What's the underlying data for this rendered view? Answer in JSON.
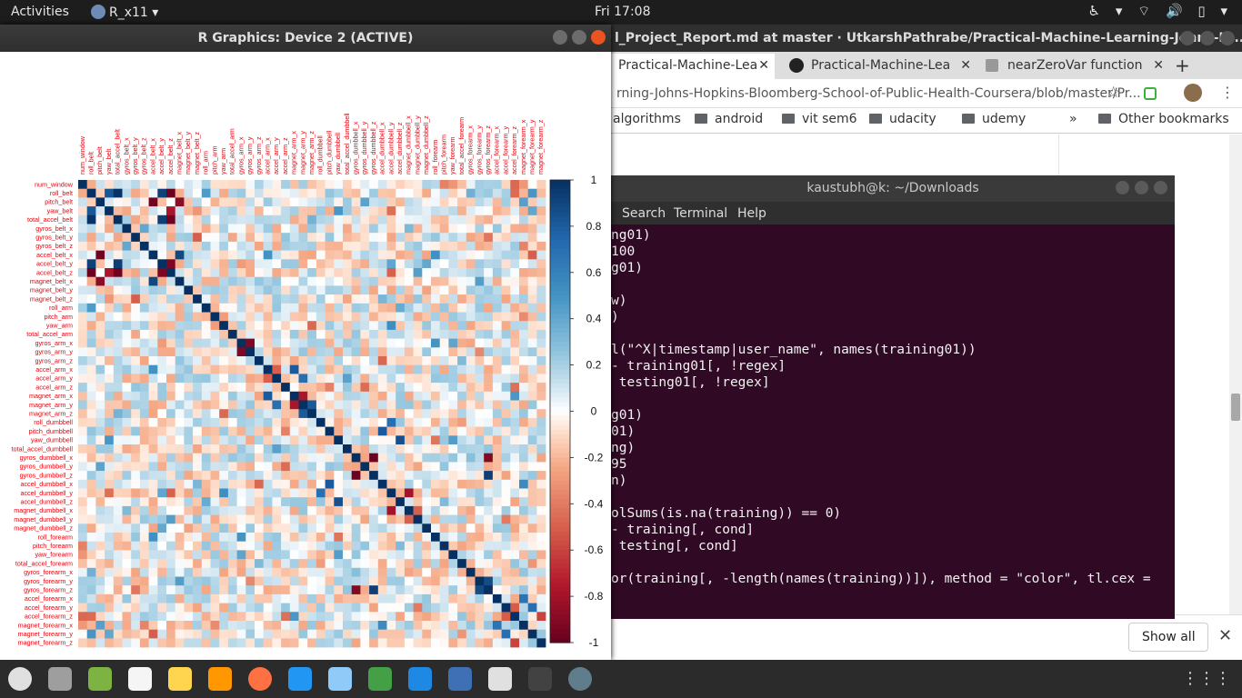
{
  "topbar": {
    "activities": "Activities",
    "app_name": "R_x11 ▾",
    "clock": "Fri 17:08",
    "tray": "♿ ▾  ⌔ 🔊 ▯ ▾"
  },
  "chrome": {
    "title": "l_Project_Report.md at master · UtkarshPathrabe/Practical-Machine-Learning-Johns-H...",
    "tabs": [
      "Practical-Machine-Lea",
      "Practical-Machine-Lea",
      "nearZeroVar function"
    ],
    "new_tab": "+",
    "url": "rning-Johns-Hopkins-Bloomberg-School-of-Public-Health-Coursera/blob/master/Pr...",
    "bookmarks": [
      "algorithms",
      "android",
      "vit sem6",
      "udacity",
      "udemy"
    ],
    "bookmarks_more": "»",
    "other_bookmarks": "Other bookmarks",
    "show_all": "Show all",
    "close": "✕"
  },
  "terminal": {
    "title": "kaustubh@k: ~/Downloads",
    "menu": [
      "Search",
      "Terminal",
      "Help"
    ],
    "lines": [
      "ng01)",
      "100",
      "g01)",
      "",
      "w)",
      ")",
      "",
      "l(\"^X|timestamp|user_name\", names(training01))",
      "- training01[, !regex]",
      " testing01[, !regex]",
      "",
      "g01)",
      "01)",
      "ng)",
      "95",
      "n)",
      "",
      "olSums(is.na(training)) == 0)",
      "- training[, cond]",
      " testing[, cond]",
      "",
      "or(training[, -length(names(training))]), method = \"color\", tl.cex ="
    ]
  },
  "rwindow": {
    "title": "R Graphics: Device 2 (ACTIVE)"
  },
  "colors": {
    "pos": "#053061",
    "neg": "#67001f",
    "label": "#e8000b"
  },
  "chart_data": {
    "type": "heatmap",
    "title": "",
    "variables": [
      "num_window",
      "roll_belt",
      "pitch_belt",
      "yaw_belt",
      "total_accel_belt",
      "gyros_belt_x",
      "gyros_belt_y",
      "gyros_belt_z",
      "accel_belt_x",
      "accel_belt_y",
      "accel_belt_z",
      "magnet_belt_x",
      "magnet_belt_y",
      "magnet_belt_z",
      "roll_arm",
      "pitch_arm",
      "yaw_arm",
      "total_accel_arm",
      "gyros_arm_x",
      "gyros_arm_y",
      "gyros_arm_z",
      "accel_arm_x",
      "accel_arm_y",
      "accel_arm_z",
      "magnet_arm_x",
      "magnet_arm_y",
      "magnet_arm_z",
      "roll_dumbbell",
      "pitch_dumbbell",
      "yaw_dumbbell",
      "total_accel_dumbbell",
      "gyros_dumbbell_x",
      "gyros_dumbbell_y",
      "gyros_dumbbell_z",
      "accel_dumbbell_x",
      "accel_dumbbell_y",
      "accel_dumbbell_z",
      "magnet_dumbbell_x",
      "magnet_dumbbell_y",
      "magnet_dumbbell_z",
      "roll_forearm",
      "pitch_forearm",
      "yaw_forearm",
      "total_accel_forearm",
      "gyros_forearm_x",
      "gyros_forearm_y",
      "gyros_forearm_z",
      "accel_forearm_x",
      "accel_forearm_y",
      "accel_forearm_z",
      "magnet_forearm_x",
      "magnet_forearm_y",
      "magnet_forearm_z"
    ],
    "colorbar_ticks": [
      "1",
      "0.8",
      "0.6",
      "0.4",
      "0.2",
      "0",
      "-0.2",
      "-0.4",
      "-0.6",
      "-0.8",
      "-1"
    ],
    "range": [
      -1,
      1
    ],
    "strong_pairs": [
      [
        "roll_belt",
        "total_accel_belt",
        0.98
      ],
      [
        "roll_belt",
        "accel_belt_z",
        -0.99
      ],
      [
        "roll_belt",
        "yaw_belt",
        0.82
      ],
      [
        "pitch_belt",
        "accel_belt_x",
        -0.97
      ],
      [
        "pitch_belt",
        "magnet_belt_x",
        -0.88
      ],
      [
        "roll_belt",
        "accel_belt_y",
        0.92
      ],
      [
        "total_accel_belt",
        "accel_belt_y",
        0.93
      ],
      [
        "total_accel_belt",
        "accel_belt_z",
        -0.97
      ],
      [
        "accel_belt_y",
        "accel_belt_z",
        -0.93
      ],
      [
        "accel_belt_x",
        "magnet_belt_x",
        0.89
      ],
      [
        "gyros_belt_x",
        "gyros_belt_z",
        0.4
      ],
      [
        "yaw_belt",
        "accel_belt_z",
        -0.78
      ],
      [
        "gyros_arm_x",
        "gyros_arm_y",
        -0.92
      ],
      [
        "accel_arm_x",
        "magnet_arm_x",
        0.81
      ],
      [
        "magnet_arm_y",
        "magnet_arm_z",
        0.81
      ],
      [
        "magnet_arm_x",
        "magnet_arm_y",
        -0.78
      ],
      [
        "accel_arm_y",
        "magnet_arm_y",
        0.7
      ],
      [
        "accel_arm_y",
        "accel_arm_x",
        -0.5
      ],
      [
        "gyros_dumbbell_x",
        "gyros_dumbbell_z",
        -0.98
      ],
      [
        "gyros_dumbbell_x",
        "gyros_forearm_z",
        -0.91
      ],
      [
        "gyros_dumbbell_z",
        "gyros_forearm_z",
        0.93
      ],
      [
        "gyros_forearm_y",
        "gyros_forearm_z",
        0.87
      ],
      [
        "accel_dumbbell_x",
        "pitch_dumbbell",
        0.81
      ],
      [
        "accel_dumbbell_z",
        "yaw_dumbbell",
        0.85
      ],
      [
        "magnet_dumbbell_x",
        "accel_dumbbell_y",
        -0.8
      ],
      [
        "accel_forearm_x",
        "magnet_forearm_x",
        0.68
      ],
      [
        "accel_forearm_y",
        "magnet_forearm_y",
        0.7
      ],
      [
        "accel_forearm_z",
        "magnet_forearm_z",
        -0.6
      ],
      [
        "roll_dumbbell",
        "accel_dumbbell_y",
        0.7
      ],
      [
        "magnet_dumbbell_y",
        "magnet_dumbbell_x",
        -0.5
      ]
    ]
  },
  "dock": {
    "icons": [
      "chrome-icon",
      "files-icon",
      "android-studio-icon",
      "text-editor-icon",
      "pikachu-icon",
      "sublime-icon",
      "firefox-icon",
      "vscode-icon",
      "virtualbox-icon",
      "pycharm-icon",
      "todo-icon",
      "r-icon",
      "screenshot-icon",
      "terminal-icon",
      "r-graphics-icon"
    ],
    "show_apps": "⋮⋮⋮"
  }
}
